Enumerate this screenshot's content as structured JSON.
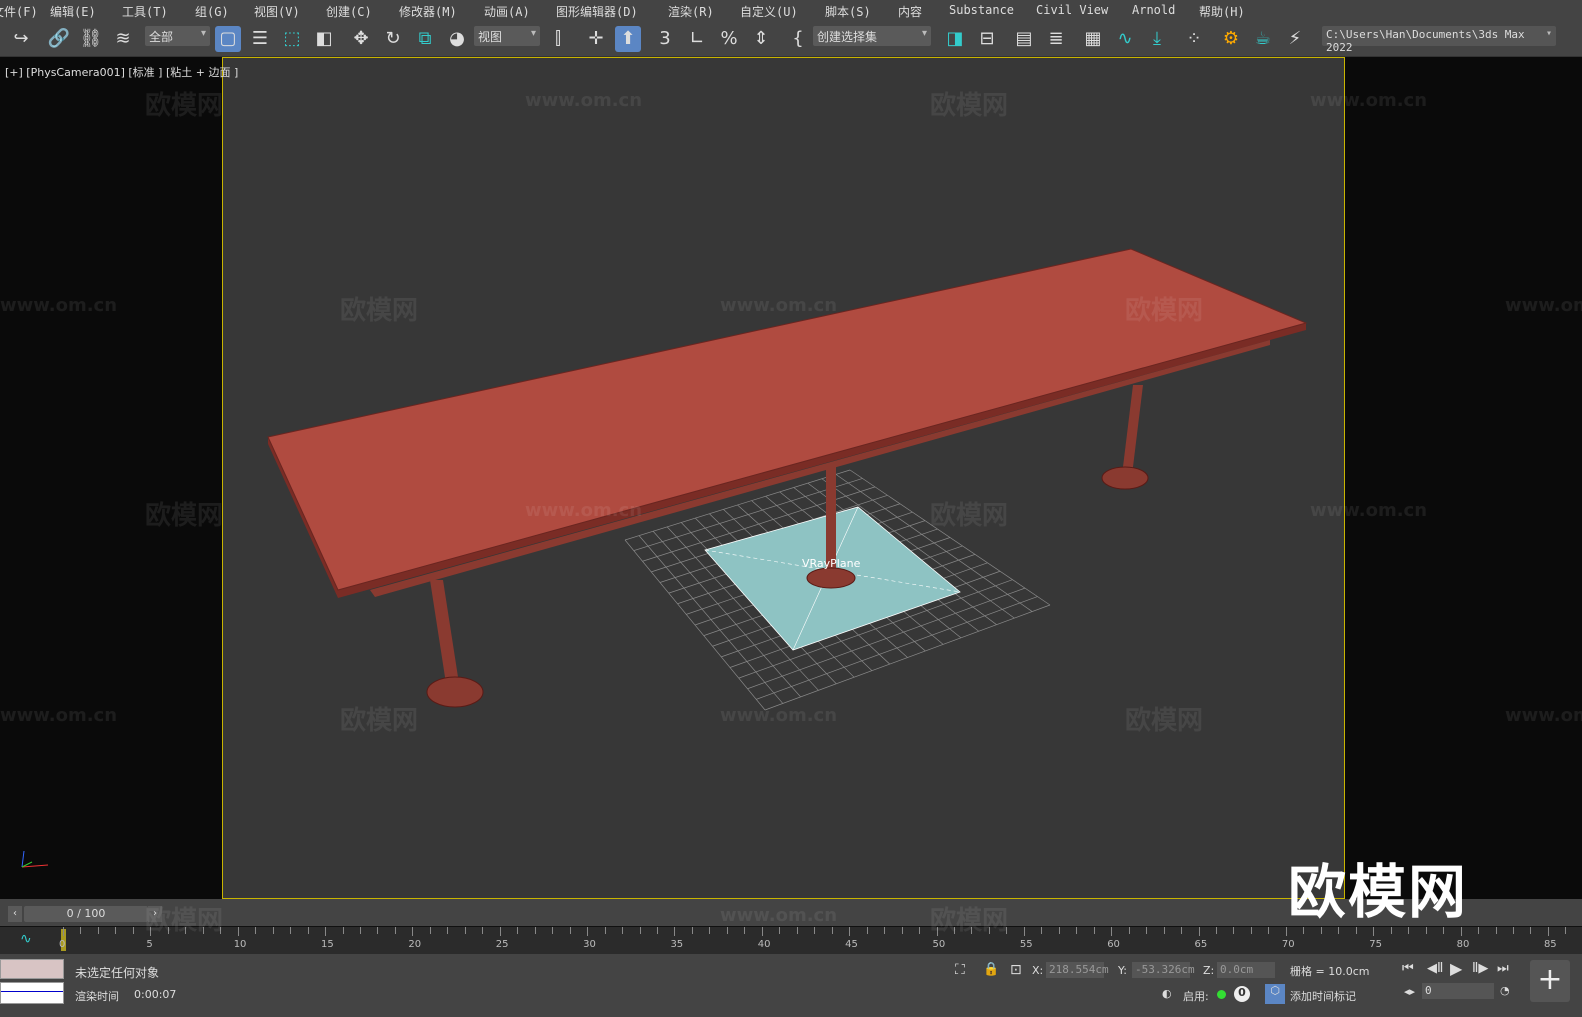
{
  "menu": [
    "文件(F)",
    "编辑(E)",
    "工具(T)",
    "组(G)",
    "视图(V)",
    "创建(C)",
    "修改器(M)",
    "动画(A)",
    "图形编辑器(D)",
    "渲染(R)",
    "自定义(U)",
    "脚本(S)",
    "内容",
    "Substance",
    "Civil View",
    "Arnold",
    "帮助(H)"
  ],
  "toolbar": {
    "filter": "全部",
    "ref_coord": "视图",
    "selection_set": "创建选择集",
    "project_path": "C:\\Users\\Han\\Documents\\3ds Max 2022"
  },
  "viewport": {
    "label": "[+] [PhysCamera001] [标准 ] [粘土 + 边面 ]",
    "object_label": "VRayPlane",
    "colors": {
      "table": "#b04b40",
      "plane": "#8ec3c3",
      "border": "#c8b400"
    }
  },
  "watermark": {
    "logo": "欧模网",
    "url": "www.om.cn"
  },
  "timeline": {
    "frame": "0 / 100",
    "ticks": [
      "0",
      "5",
      "10",
      "15",
      "20",
      "25",
      "30",
      "35",
      "40",
      "45",
      "50",
      "55",
      "60",
      "65",
      "70",
      "75",
      "80",
      "85"
    ]
  },
  "status": {
    "selection": "未选定任何对象",
    "render_time_label": "渲染时间",
    "render_time": "0:00:07",
    "x_label": "X:",
    "x": "218.554cm",
    "y_label": "Y:",
    "y": "-53.326cm",
    "z_label": "Z:",
    "z": "0.0cm",
    "grid": "栅格 = 10.0cm",
    "enable_label": "启用:",
    "add_time_tag": "添加时间标记",
    "frame_value": "0"
  }
}
